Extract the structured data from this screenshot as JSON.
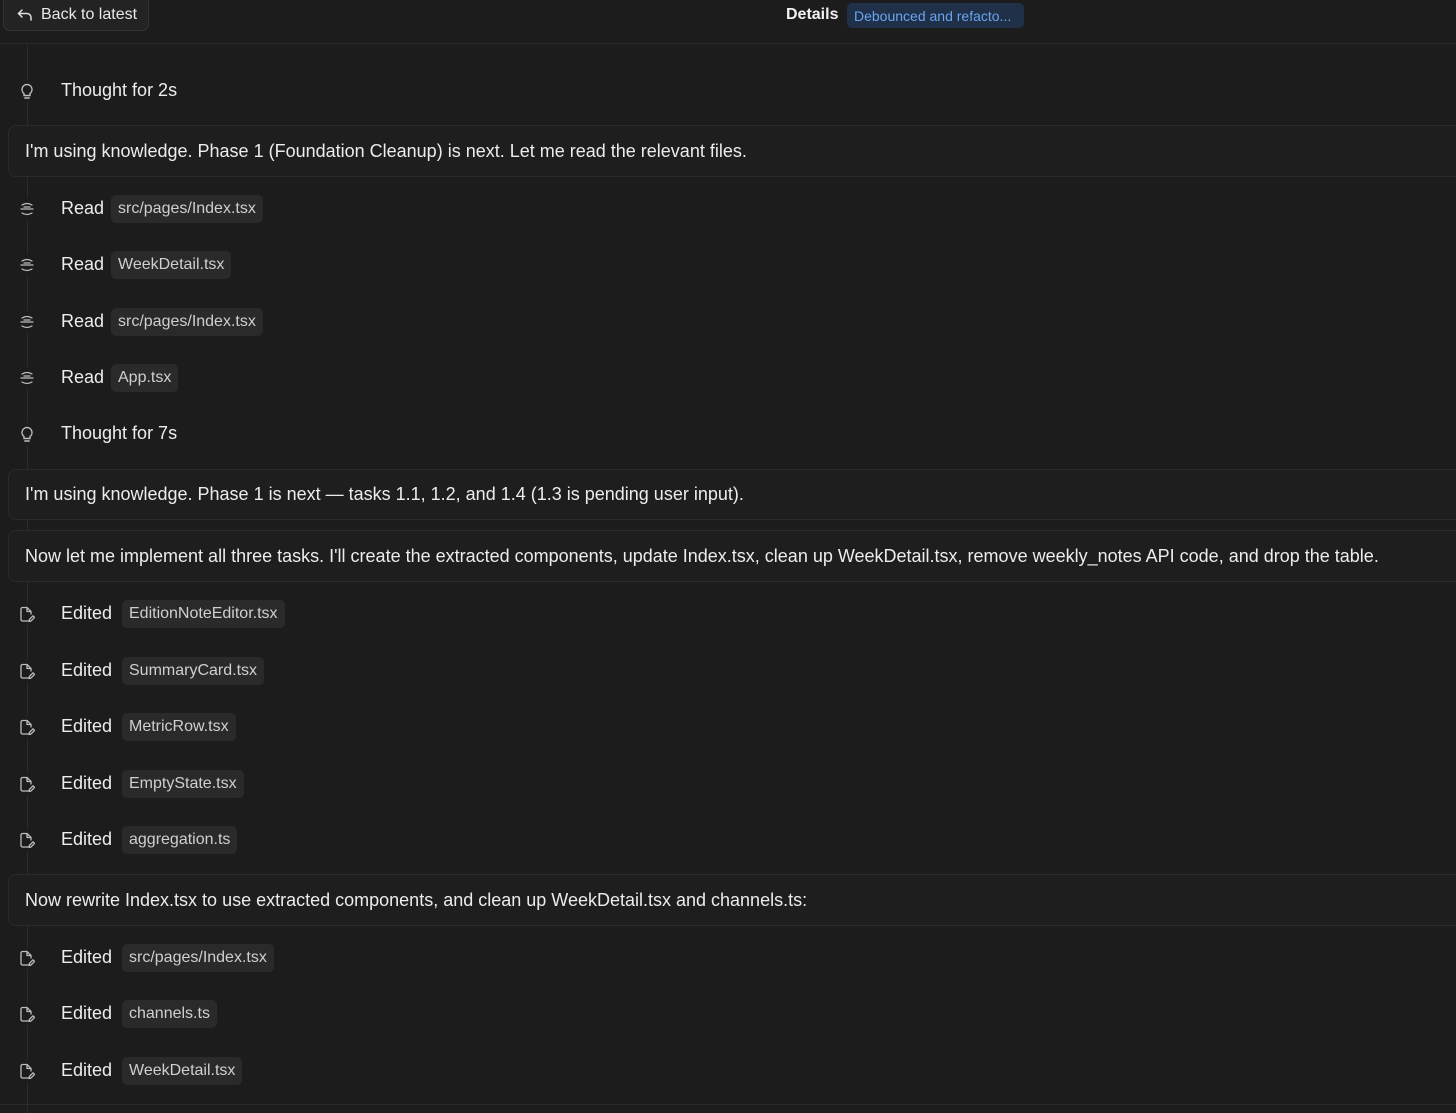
{
  "header": {
    "back_label": "Back to latest",
    "details_label": "Details",
    "badge_label": "Debounced and refacto..."
  },
  "timeline": [
    {
      "kind": "thought",
      "icon": "lightbulb-icon",
      "verb": "Thought for 2s"
    },
    {
      "kind": "message",
      "text": "I'm using knowledge. Phase 1 (Foundation Cleanup) is next. Let me read the relevant files."
    },
    {
      "kind": "read",
      "icon": "read-file-icon",
      "verb": "Read",
      "file": "src/pages/Index.tsx"
    },
    {
      "kind": "read",
      "icon": "read-file-icon",
      "verb": "Read",
      "file": "WeekDetail.tsx"
    },
    {
      "kind": "read",
      "icon": "read-file-icon",
      "verb": "Read",
      "file": "src/pages/Index.tsx"
    },
    {
      "kind": "read",
      "icon": "read-file-icon",
      "verb": "Read",
      "file": "App.tsx"
    },
    {
      "kind": "thought",
      "icon": "lightbulb-icon",
      "verb": "Thought for 7s"
    },
    {
      "kind": "message",
      "text": "I'm using knowledge. Phase 1 is next — tasks 1.1, 1.2, and 1.4 (1.3 is pending user input)."
    },
    {
      "kind": "message",
      "text": "Now let me implement all three tasks. I'll create the extracted components, update Index.tsx, clean up WeekDetail.tsx, remove weekly_notes API code, and drop the table."
    },
    {
      "kind": "edit",
      "icon": "edit-file-icon",
      "verb": "Edited",
      "file": "EditionNoteEditor.tsx"
    },
    {
      "kind": "edit",
      "icon": "edit-file-icon",
      "verb": "Edited",
      "file": "SummaryCard.tsx"
    },
    {
      "kind": "edit",
      "icon": "edit-file-icon",
      "verb": "Edited",
      "file": "MetricRow.tsx"
    },
    {
      "kind": "edit",
      "icon": "edit-file-icon",
      "verb": "Edited",
      "file": "EmptyState.tsx"
    },
    {
      "kind": "edit",
      "icon": "edit-file-icon",
      "verb": "Edited",
      "file": "aggregation.ts"
    },
    {
      "kind": "message",
      "text": "Now rewrite Index.tsx to use extracted components, and clean up WeekDetail.tsx and channels.ts:"
    },
    {
      "kind": "edit",
      "icon": "edit-file-icon",
      "verb": "Edited",
      "file": "src/pages/Index.tsx"
    },
    {
      "kind": "edit",
      "icon": "edit-file-icon",
      "verb": "Edited",
      "file": "channels.ts"
    },
    {
      "kind": "edit",
      "icon": "edit-file-icon",
      "verb": "Edited",
      "file": "WeekDetail.tsx"
    }
  ],
  "colors": {
    "background": "#1c1c1c",
    "badge_bg": "#1f3048",
    "badge_text": "#6aa4f0",
    "chip_bg": "#2a2a2a"
  }
}
